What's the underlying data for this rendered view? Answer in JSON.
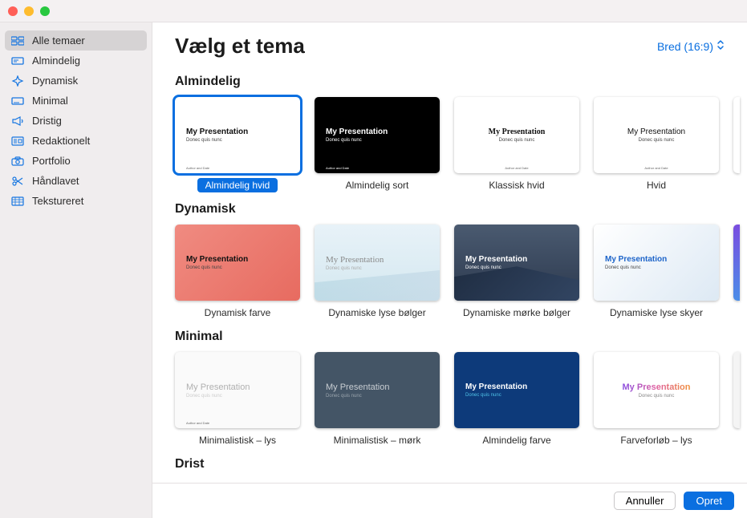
{
  "header": {
    "title": "Vælg et tema",
    "aspect_label": "Bred (16:9)"
  },
  "sidebar": {
    "items": [
      {
        "label": "Alle temaer"
      },
      {
        "label": "Almindelig"
      },
      {
        "label": "Dynamisk"
      },
      {
        "label": "Minimal"
      },
      {
        "label": "Dristig"
      },
      {
        "label": "Redaktionelt"
      },
      {
        "label": "Portfolio"
      },
      {
        "label": "Håndlavet"
      },
      {
        "label": "Tekstureret"
      }
    ]
  },
  "sections": {
    "almindelig": {
      "title": "Almindelig",
      "themes": [
        {
          "label": "Almindelig hvid"
        },
        {
          "label": "Almindelig sort"
        },
        {
          "label": "Klassisk hvid"
        },
        {
          "label": "Hvid"
        }
      ]
    },
    "dynamisk": {
      "title": "Dynamisk",
      "themes": [
        {
          "label": "Dynamisk farve"
        },
        {
          "label": "Dynamiske lyse bølger"
        },
        {
          "label": "Dynamiske mørke bølger"
        },
        {
          "label": "Dynamiske lyse skyer"
        }
      ]
    },
    "minimal": {
      "title": "Minimal",
      "themes": [
        {
          "label": "Minimalistisk – lys"
        },
        {
          "label": "Minimalistisk – mørk"
        },
        {
          "label": "Almindelig farve"
        },
        {
          "label": "Farveforløb – lys"
        }
      ]
    },
    "drist": {
      "title": "Drist"
    }
  },
  "sample": {
    "title": "My Presentation",
    "sub": "Donec quis nunc",
    "footer": "Author and Date"
  },
  "footer": {
    "cancel": "Annuller",
    "create": "Opret"
  }
}
